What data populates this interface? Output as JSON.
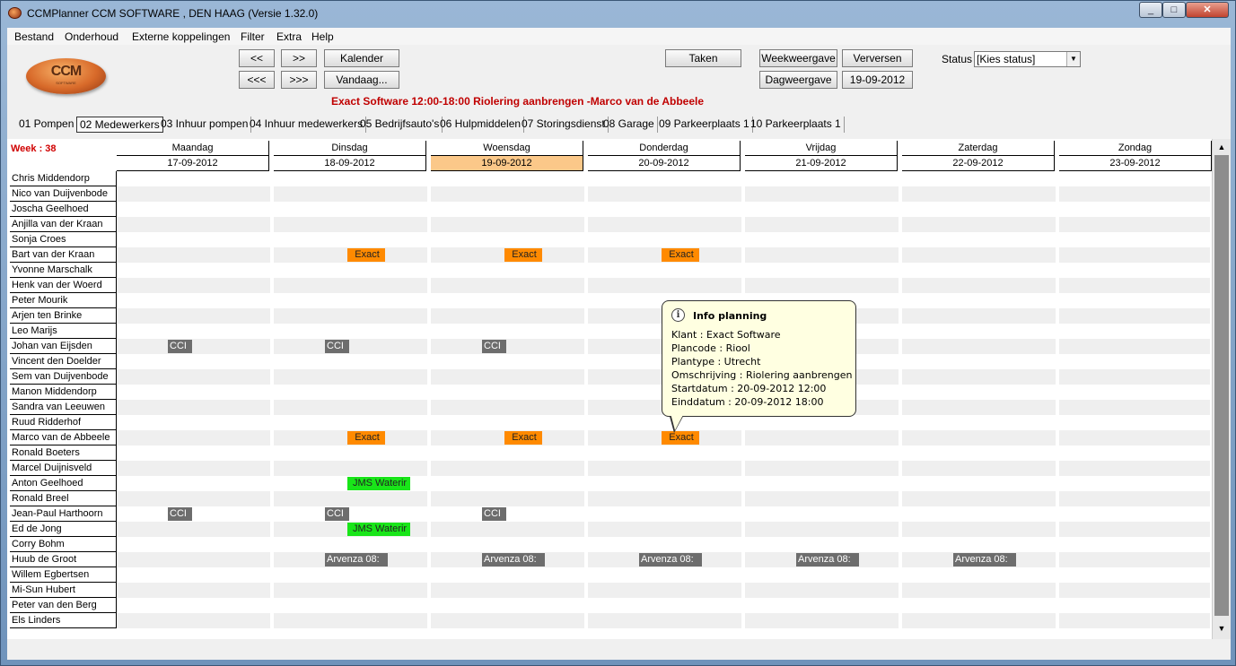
{
  "window": {
    "title": "CCMPlanner CCM SOFTWARE , DEN HAAG (Versie 1.32.0)",
    "min": "_",
    "max": "□",
    "close": "✕"
  },
  "menu": [
    "Bestand",
    "Onderhoud",
    "Externe koppelingen",
    "Filter",
    "Extra",
    "Help"
  ],
  "logo": {
    "text": "CCM",
    "sub": "SOFTWARE"
  },
  "nav": {
    "prev": "<<",
    "next": ">>",
    "prev_far": "<<<",
    "next_far": ">>>",
    "kalender": "Kalender",
    "vandaag": "Vandaag..."
  },
  "toolbar": {
    "taken": "Taken",
    "weekweergave": "Weekweergave",
    "verversen": "Verversen",
    "dagweergave": "Dagweergave",
    "date": "19-09-2012"
  },
  "status": {
    "label": "Status",
    "value": "[Kies status]"
  },
  "headline": "Exact Software 12:00-18:00 Riolering aanbrengen  -Marco van de Abbeele",
  "tabs": [
    "01 Pompen",
    "02 Medewerkers",
    "03 Inhuur pompen",
    "04 Inhuur medewerkers",
    "05 Bedrijfsauto's",
    "06 Hulpmiddelen",
    "07 Storingsdienst",
    "08 Garage",
    "09 Parkeerplaats 1",
    "10 Parkeerplaats 1"
  ],
  "active_tab": "02 Medewerkers",
  "week_label": "Week : 38",
  "days": [
    {
      "name": "Maandag",
      "date": "17-09-2012"
    },
    {
      "name": "Dinsdag",
      "date": "18-09-2012"
    },
    {
      "name": "Woensdag",
      "date": "19-09-2012"
    },
    {
      "name": "Donderdag",
      "date": "20-09-2012"
    },
    {
      "name": "Vrijdag",
      "date": "21-09-2012"
    },
    {
      "name": "Zaterdag",
      "date": "22-09-2012"
    },
    {
      "name": "Zondag",
      "date": "23-09-2012"
    }
  ],
  "today_index": 2,
  "employees": [
    "Chris Middendorp",
    "Nico van Duijvenbode",
    "Joscha Geelhoed",
    "Anjilla van der Kraan",
    "Sonja Croes",
    "Bart van der Kraan",
    "Yvonne Marschalk",
    "Henk van der Woerd",
    "Peter Mourik",
    "Arjen ten Brinke",
    "Leo Marijs",
    "Johan van Eijsden",
    "Vincent den Doelder",
    "Sem van Duijvenbode",
    "Manon Middendorp",
    "Sandra van Leeuwen",
    "Ruud Ridderhof",
    "Marco van de Abbeele",
    "Ronald Boeters",
    "Marcel Duijnisveld",
    "Anton Geelhoed",
    "Ronald Breel",
    "Jean-Paul Harthoorn",
    "Ed de Jong",
    "Corry Bohm",
    "Huub de Groot",
    "Willem Egbertsen",
    "Mi-Sun Hubert",
    "Peter van den Berg",
    "Els Linders"
  ],
  "appointments": [
    {
      "row": 5,
      "day": 1,
      "label": "Exact",
      "color": "orange"
    },
    {
      "row": 5,
      "day": 2,
      "label": "Exact",
      "color": "orange"
    },
    {
      "row": 5,
      "day": 3,
      "label": "Exact",
      "color": "orange"
    },
    {
      "row": 11,
      "day": 0,
      "label": "CCI",
      "color": "gray"
    },
    {
      "row": 11,
      "day": 1,
      "label": "CCI",
      "color": "gray"
    },
    {
      "row": 11,
      "day": 2,
      "label": "CCI",
      "color": "gray"
    },
    {
      "row": 17,
      "day": 1,
      "label": "Exact",
      "color": "orange"
    },
    {
      "row": 17,
      "day": 2,
      "label": "Exact",
      "color": "orange"
    },
    {
      "row": 17,
      "day": 3,
      "label": "Exact",
      "color": "orange"
    },
    {
      "row": 20,
      "day": 1,
      "label": "JMS Waterir",
      "color": "green"
    },
    {
      "row": 22,
      "day": 0,
      "label": "CCI",
      "color": "gray"
    },
    {
      "row": 22,
      "day": 1,
      "label": "CCI",
      "color": "gray"
    },
    {
      "row": 22,
      "day": 2,
      "label": "CCI",
      "color": "gray"
    },
    {
      "row": 23,
      "day": 1,
      "label": "JMS Waterir",
      "color": "green"
    },
    {
      "row": 25,
      "day": 1,
      "label": "Arvenza 08:",
      "color": "gray"
    },
    {
      "row": 25,
      "day": 2,
      "label": "Arvenza 08:",
      "color": "gray"
    },
    {
      "row": 25,
      "day": 3,
      "label": "Arvenza 08:",
      "color": "gray"
    },
    {
      "row": 25,
      "day": 4,
      "label": "Arvenza 08:",
      "color": "gray"
    },
    {
      "row": 25,
      "day": 5,
      "label": "Arvenza 08:",
      "color": "gray"
    }
  ],
  "tooltip": {
    "title": "Info planning",
    "icon": "i",
    "lines": [
      "Klant : Exact Software",
      "Plancode : Riool",
      "Plantype : Utrecht",
      "Omschrijving : Riolering aanbrengen",
      "Startdatum : 20-09-2012 12:00",
      "Einddatum : 20-09-2012 18:00"
    ]
  },
  "scrollbar": {
    "up": "▲",
    "down": "▼"
  },
  "colors": {
    "orange": "#ff8a00",
    "gray": "#6d6d6d",
    "green": "#19e519",
    "today": "#fbc889",
    "headline": "#c00000"
  }
}
